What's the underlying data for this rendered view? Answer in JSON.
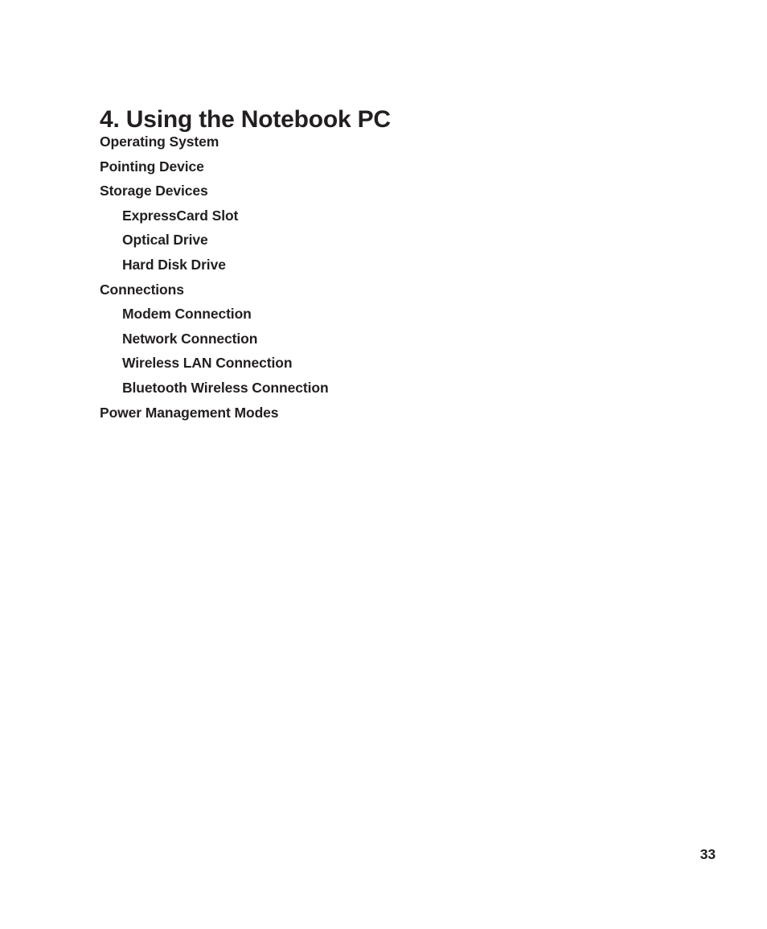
{
  "document": {
    "chapter_title": "4. Using the Notebook PC",
    "page_number": "33",
    "text_color": "#231f20",
    "background_color": "#ffffff"
  },
  "toc": {
    "entries": [
      {
        "label": "Operating System",
        "level": 1
      },
      {
        "label": "Pointing Device",
        "level": 1
      },
      {
        "label": "Storage Devices",
        "level": 1
      },
      {
        "label": "ExpressCard Slot",
        "level": 2
      },
      {
        "label": "Optical Drive",
        "level": 2
      },
      {
        "label": "Hard Disk Drive",
        "level": 2
      },
      {
        "label": "Connections",
        "level": 1
      },
      {
        "label": "Modem Connection",
        "level": 2
      },
      {
        "label": "Network Connection",
        "level": 2
      },
      {
        "label": "Wireless LAN Connection",
        "level": 2
      },
      {
        "label": "Bluetooth Wireless Connection",
        "level": 2
      },
      {
        "label": "Power Management Modes",
        "level": 1
      }
    ]
  }
}
